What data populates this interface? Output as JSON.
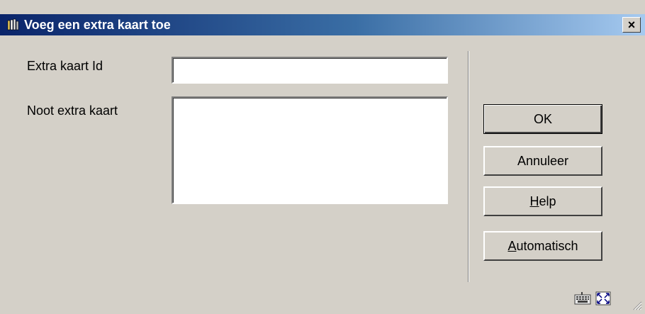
{
  "window": {
    "title": "Voeg een extra kaart toe",
    "close_label": "×"
  },
  "form": {
    "extra_kaart_id_label": "Extra kaart Id",
    "extra_kaart_id_value": "",
    "noot_label": "Noot extra kaart",
    "noot_value": ""
  },
  "buttons": {
    "ok": "OK",
    "cancel": "Annuleer",
    "help_mnemonic": "H",
    "help_rest": "elp",
    "auto_mnemonic": "A",
    "auto_rest": "utomatisch"
  },
  "icons": {
    "app": "library-icon",
    "keyboard": "keyboard-icon",
    "fullscreen": "fullscreen-icon",
    "grip": "resize-grip-icon"
  },
  "colors": {
    "title_start": "#0a246a",
    "title_end": "#a6caf0",
    "face": "#d4d0c8"
  }
}
